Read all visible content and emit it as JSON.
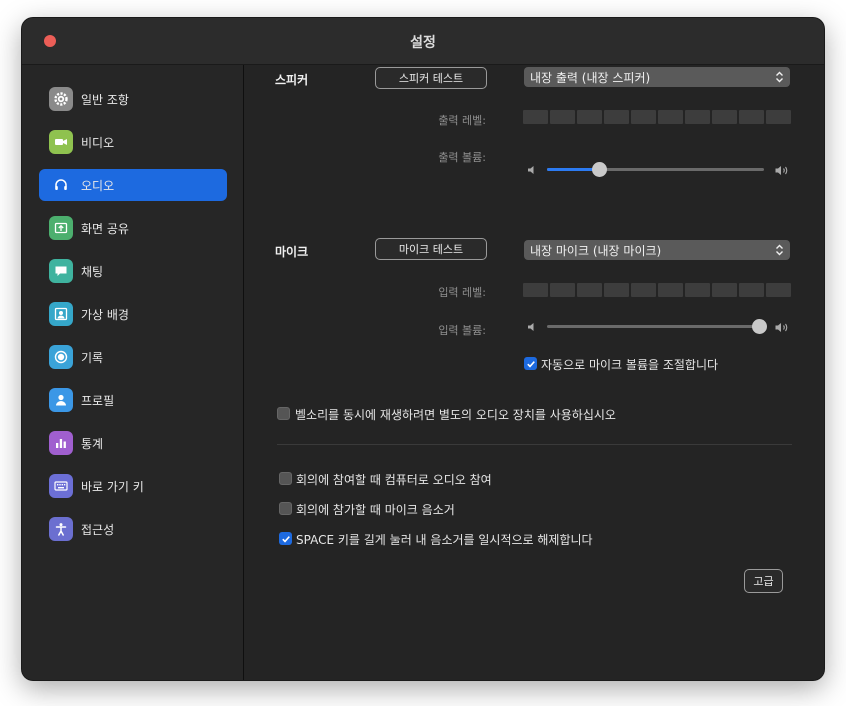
{
  "window": {
    "title": "설정"
  },
  "sidebar": {
    "items": [
      {
        "label": "일반 조항",
        "icon": "gear-icon",
        "color": "#8a8a8a",
        "active": false
      },
      {
        "label": "비디오",
        "icon": "video-camera-icon",
        "color": "#8fc24f",
        "active": false
      },
      {
        "label": "오디오",
        "icon": "headphones-icon",
        "color": "#1d6ae0",
        "active": true
      },
      {
        "label": "화면 공유",
        "icon": "screen-share-icon",
        "color": "#4caf6e",
        "active": false
      },
      {
        "label": "채팅",
        "icon": "chat-bubble-icon",
        "color": "#3fb39f",
        "active": false
      },
      {
        "label": "가상 배경",
        "icon": "person-background-icon",
        "color": "#35a7c9",
        "active": false
      },
      {
        "label": "기록",
        "icon": "record-icon",
        "color": "#3aa3d8",
        "active": false
      },
      {
        "label": "프로필",
        "icon": "person-icon",
        "color": "#3b97e6",
        "active": false
      },
      {
        "label": "통계",
        "icon": "bar-chart-icon",
        "color": "#a05fcf",
        "active": false
      },
      {
        "label": "바로 가기 키",
        "icon": "keyboard-icon",
        "color": "#6c6fd6",
        "active": false
      },
      {
        "label": "접근성",
        "icon": "accessibility-icon",
        "color": "#6b6fd0",
        "active": false
      }
    ]
  },
  "speaker": {
    "label": "스피커",
    "test_button": "스피커 테스트",
    "device": "내장 출력 (내장 스피커)",
    "level_label": "출력 레벨:",
    "volume_label": "출력 볼륨:",
    "volume_percent": 24
  },
  "mic": {
    "label": "마이크",
    "test_button": "마이크 테스트",
    "device": "내장 마이크 (내장 마이크)",
    "level_label": "입력 레벨:",
    "volume_label": "입력 볼륨:",
    "volume_percent": 98,
    "auto_adjust_label": "자동으로 마이크 볼륨을 조절합니다",
    "auto_adjust_checked": true
  },
  "options": {
    "separate_ringer_label": "벨소리를 동시에 재생하려면 별도의 오디오 장치를 사용하십시오",
    "separate_ringer_checked": false,
    "join_computer_audio_label": "회의에 참여할 때 컴퓨터로 오디오 참여",
    "join_computer_audio_checked": false,
    "mute_on_join_label": "회의에 참가할 때 마이크 음소거",
    "mute_on_join_checked": false,
    "space_unmute_label": "SPACE 키를 길게 눌러 내 음소거를 일시적으로 해제합니다",
    "space_unmute_checked": true
  },
  "advanced_button": "고급"
}
